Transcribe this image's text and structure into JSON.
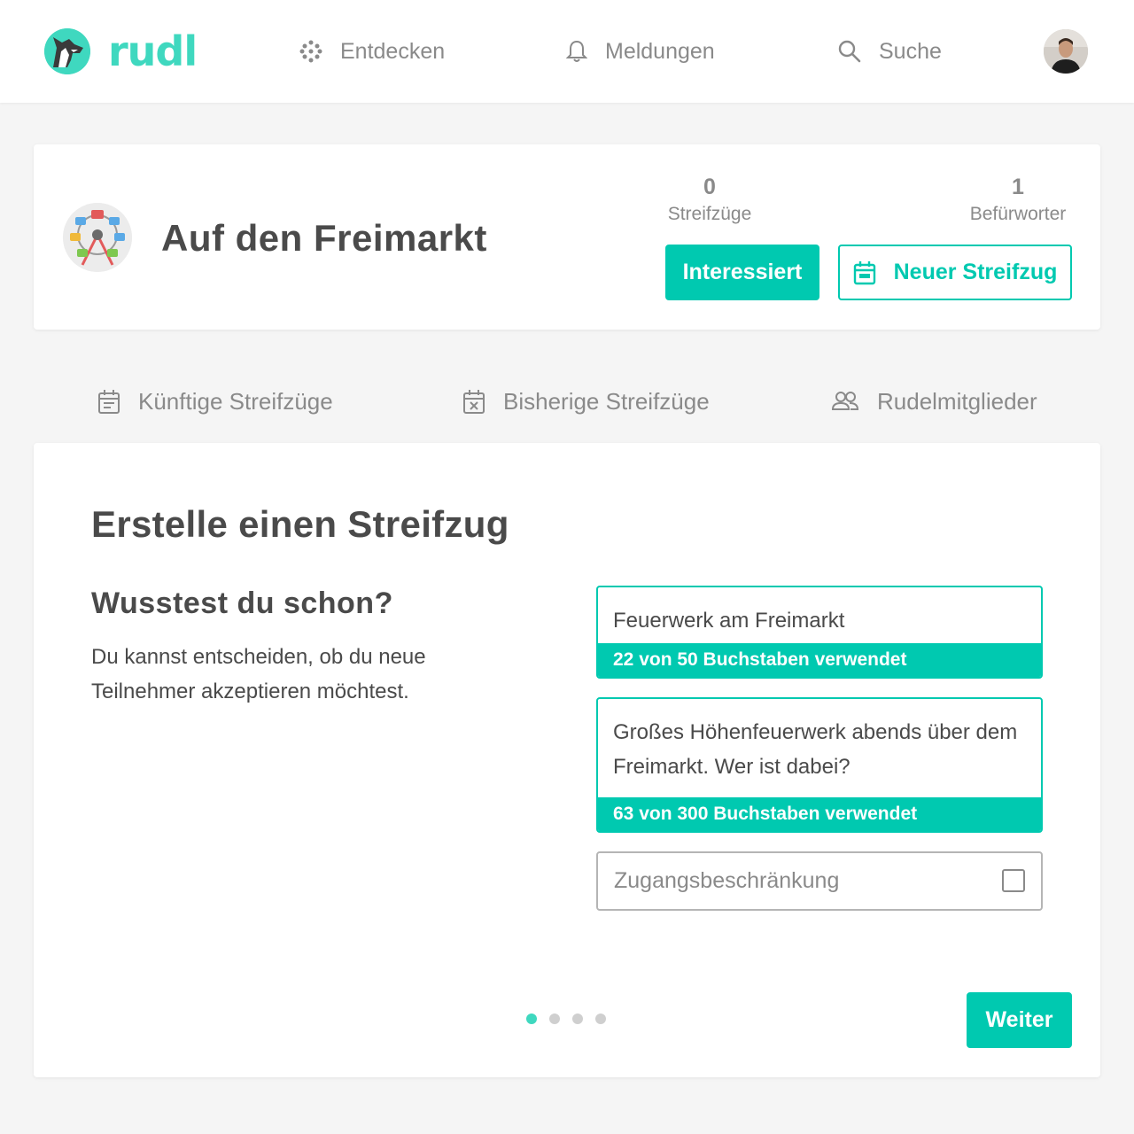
{
  "header": {
    "logo_text": "rudl",
    "nav": [
      {
        "label": "Entdecken",
        "icon": "grid-dots-icon"
      },
      {
        "label": "Meldungen",
        "icon": "bell-icon"
      },
      {
        "label": "Suche",
        "icon": "search-icon"
      }
    ]
  },
  "event": {
    "title": "Auf den Freimarkt",
    "stats": [
      {
        "value": "0",
        "label": "Streifzüge"
      },
      {
        "value": "1",
        "label": "Befürworter"
      }
    ],
    "interested_label": "Interessiert",
    "new_trip_label": "Neuer Streifzug"
  },
  "tabs": [
    {
      "label": "Künftige Streifzüge",
      "icon": "calendar-icon"
    },
    {
      "label": "Bisherige Streifzüge",
      "icon": "calendar-x-icon"
    },
    {
      "label": "Rudelmitglieder",
      "icon": "people-icon"
    }
  ],
  "form": {
    "title": "Erstelle einen Streifzug",
    "tip_title": "Wusstest du schon?",
    "tip_text": "Du kannst entscheiden, ob du neue Teilnehmer akzeptieren möchtest.",
    "name_value": "Feuerwerk am Freimarkt",
    "name_counter": "22 von 50 Buchstaben verwendet",
    "description_value": "Großes Höhenfeuerwerk abends über dem Freimarkt. Wer ist dabei?",
    "description_counter": "63 von 300 Buchstaben verwendet",
    "restriction_label": "Zugangsbeschränkung",
    "restriction_checked": false,
    "steps_total": 4,
    "step_current": 1,
    "next_label": "Weiter"
  },
  "colors": {
    "accent": "#00c9b0",
    "logo": "#3fd8bf",
    "text": "#4a4a4a",
    "muted": "#8a8a8a",
    "background": "#f5f5f5"
  }
}
